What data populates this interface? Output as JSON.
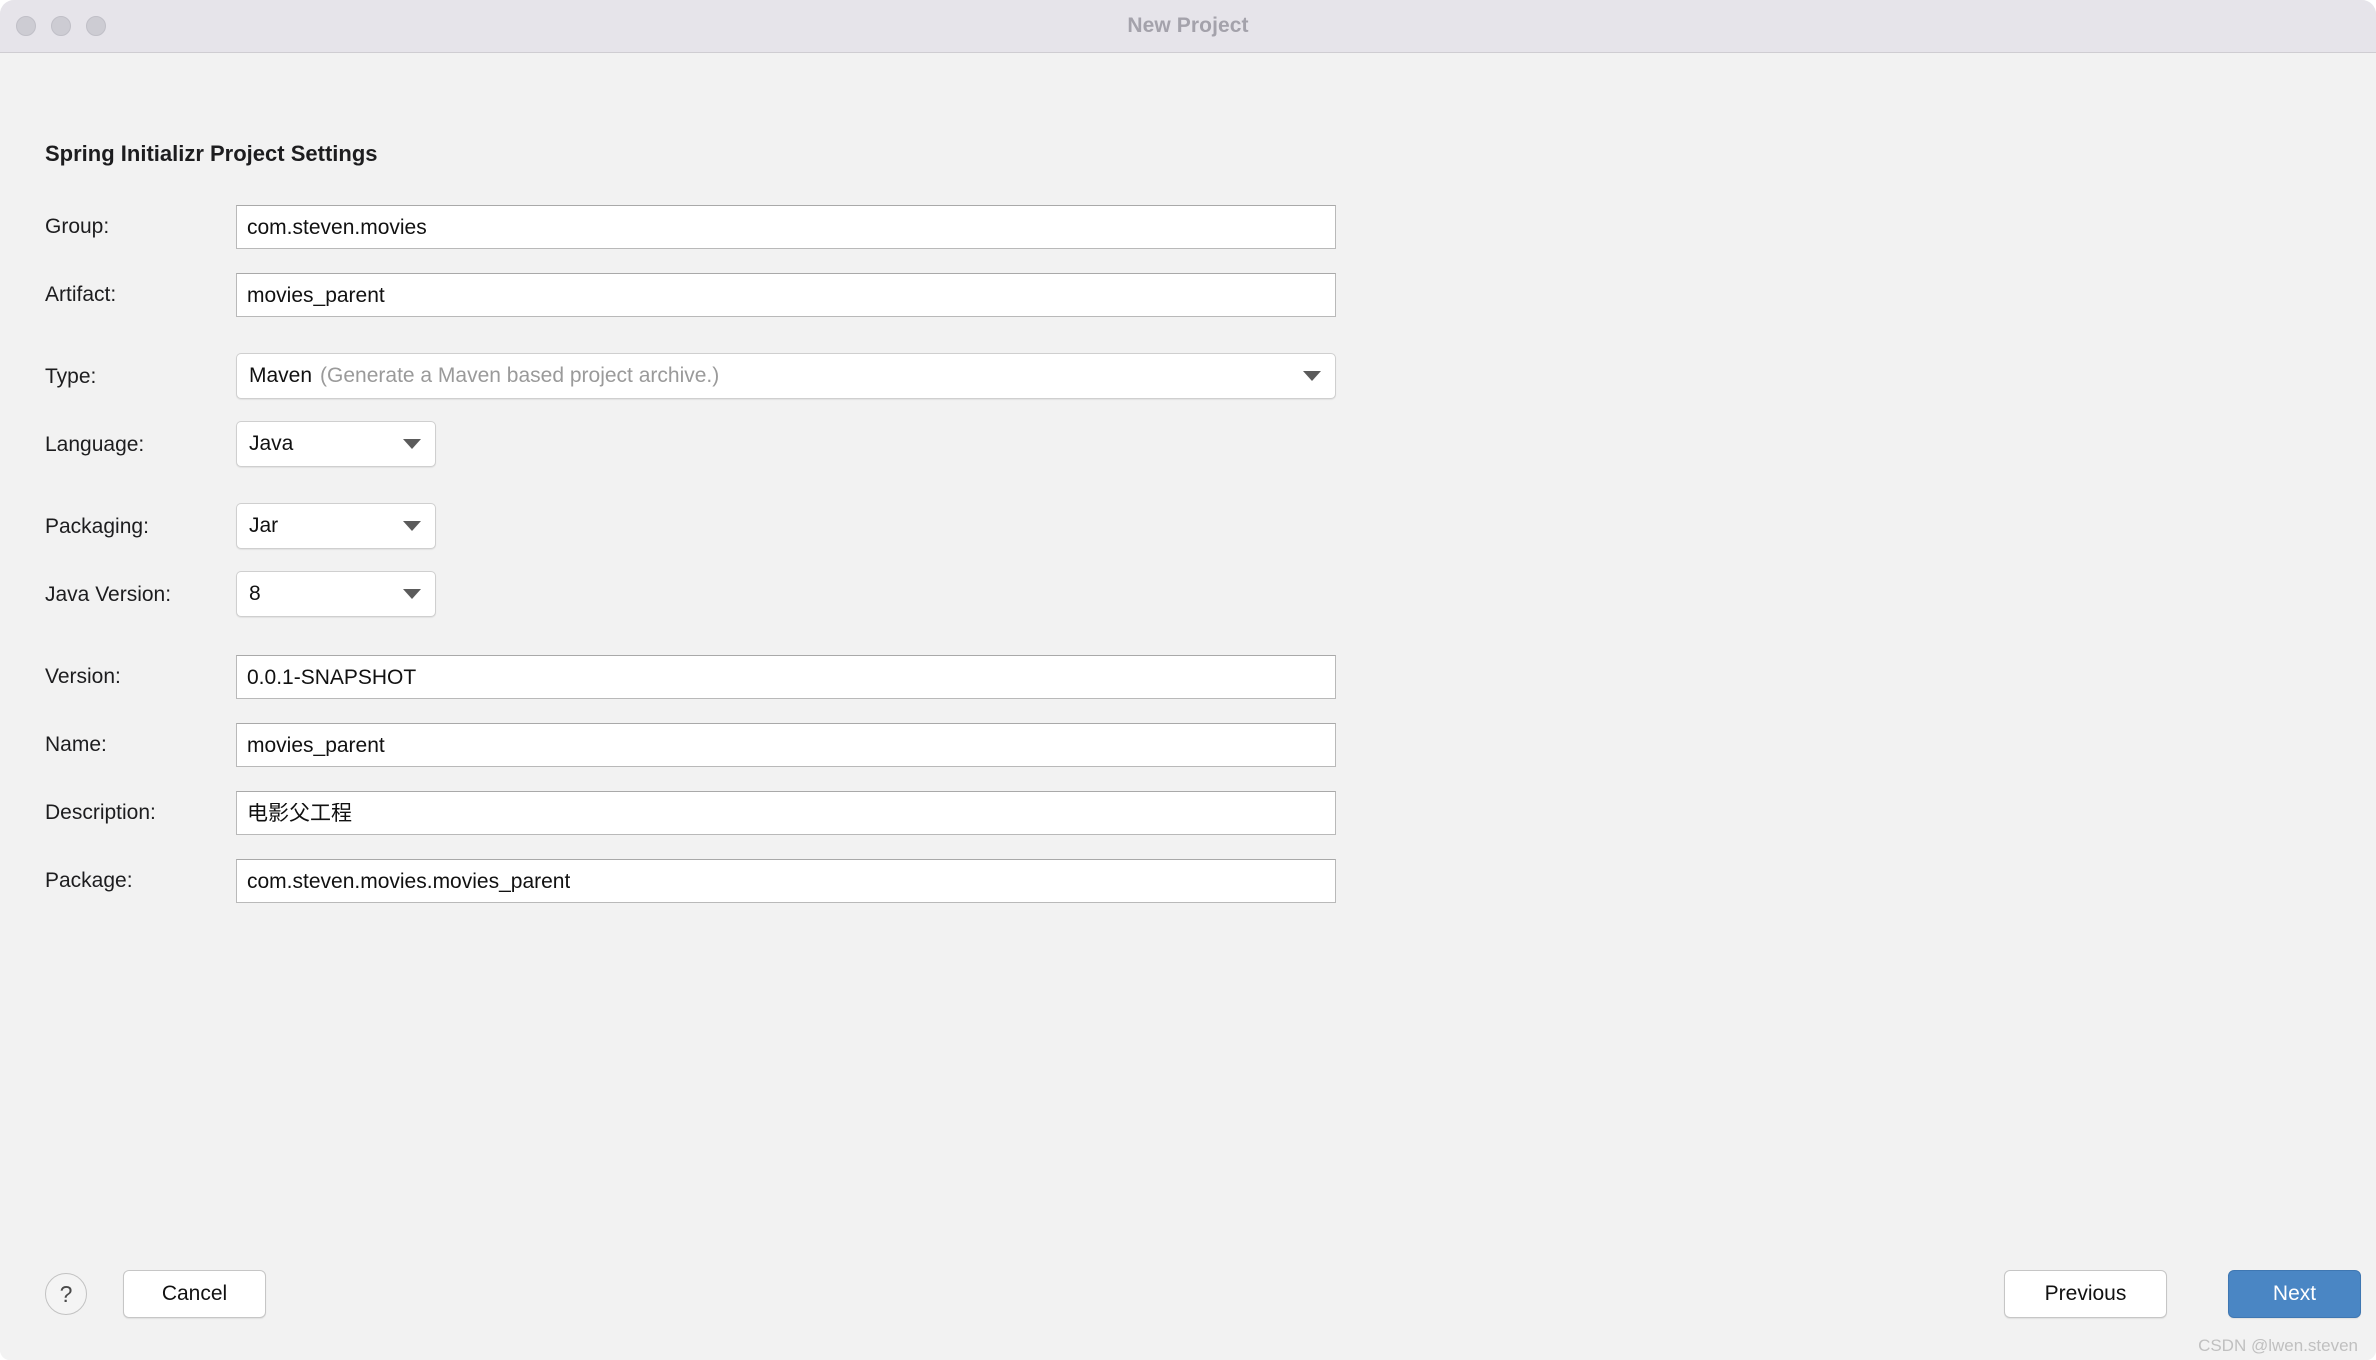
{
  "window": {
    "title": "New Project",
    "traffic_lights": [
      "close",
      "minimize",
      "zoom"
    ]
  },
  "section": {
    "title": "Spring Initializr Project Settings"
  },
  "form": {
    "fields": [
      {
        "label": "Group:",
        "value": "com.steven.movies",
        "kind": "text"
      },
      {
        "label": "Artifact:",
        "value": "movies_parent",
        "kind": "text"
      },
      {
        "label": "Type:",
        "value": "Maven",
        "hint": "(Generate a Maven based project archive.)",
        "kind": "combo-wide"
      },
      {
        "label": "Language:",
        "value": "Java",
        "kind": "combo-small"
      },
      {
        "label": "Packaging:",
        "value": "Jar",
        "kind": "combo-small"
      },
      {
        "label": "Java Version:",
        "value": "8",
        "kind": "combo-small"
      },
      {
        "label": "Version:",
        "value": "0.0.1-SNAPSHOT",
        "kind": "text"
      },
      {
        "label": "Name:",
        "value": "movies_parent",
        "kind": "text"
      },
      {
        "label": "Description:",
        "value": "电影父工程",
        "kind": "text"
      },
      {
        "label": "Package:",
        "value": "com.steven.movies.movies_parent",
        "kind": "text"
      }
    ]
  },
  "footer": {
    "help_label": "?",
    "cancel_label": "Cancel",
    "previous_label": "Previous",
    "next_label": "Next",
    "watermark": "CSDN @lwen.steven"
  },
  "colors": {
    "titlebar_bg": "#e6e4ea",
    "content_bg": "#f2f2f2",
    "accent_blue": "#4a86c4",
    "title_text": "#a4a2ab",
    "hint_text": "#9a9a9a"
  }
}
